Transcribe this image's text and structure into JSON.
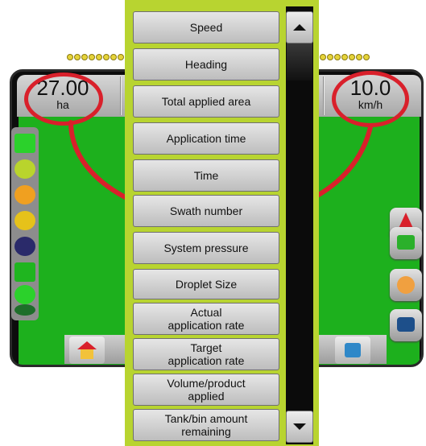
{
  "colors": {
    "highlight": "#d9202b",
    "panel_border": "#b8d430",
    "field": "#1db01d"
  },
  "readouts": {
    "left": {
      "value": "27.00",
      "unit": "ha"
    },
    "right": {
      "value": "10.0",
      "unit": "km/h"
    }
  },
  "menu": {
    "items": [
      {
        "label": "Speed"
      },
      {
        "label": "Heading"
      },
      {
        "label": "Total applied area"
      },
      {
        "label": "Application time"
      },
      {
        "label": "Time"
      },
      {
        "label": "Swath number"
      },
      {
        "label": "System pressure"
      },
      {
        "label": "Droplet Size"
      },
      {
        "label": "Actual\napplication rate"
      },
      {
        "label": "Target\napplication rate"
      },
      {
        "label": "Volume/product\napplied"
      },
      {
        "label": "Tank/bin amount\nremaining"
      }
    ],
    "scroll_up_icon": "triangle-up-icon",
    "scroll_down_icon": "triangle-down-icon"
  },
  "side_icons": {
    "left": [
      "implement-icon",
      "section-icon",
      "warning-icon",
      "gps-icon",
      "boom-icon",
      "guidance-icon",
      "droplet-icon",
      "operator-icon"
    ],
    "right": [
      "nav-arrow-icon",
      "map-icon",
      "hand-icon",
      "chat-icon"
    ],
    "bottom": [
      "home-icon",
      "menu-icon"
    ]
  }
}
